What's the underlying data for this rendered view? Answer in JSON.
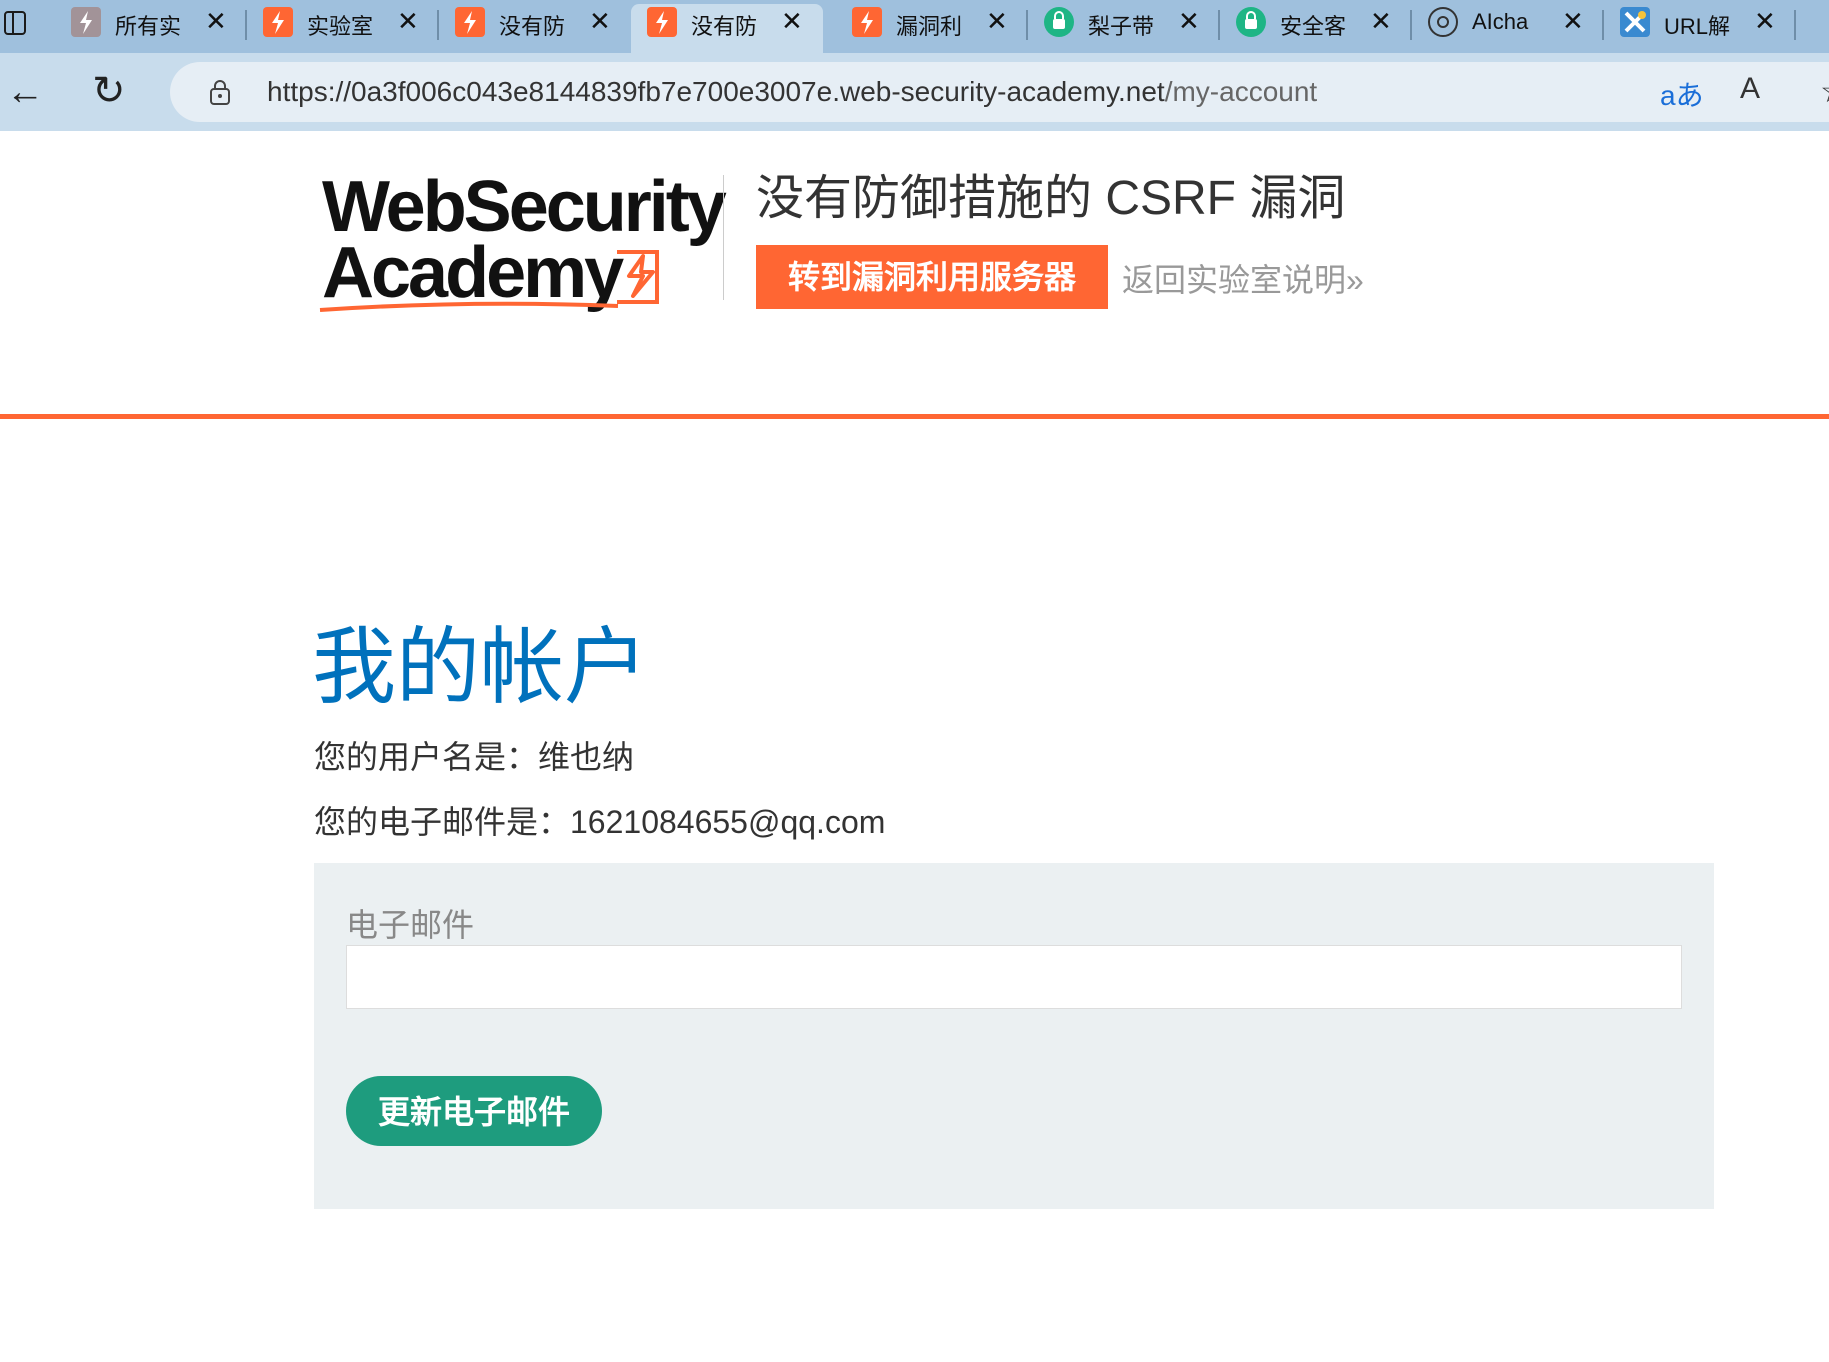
{
  "browser": {
    "tabs": [
      {
        "title": "所有实",
        "favicon": "grey-bolt-icon"
      },
      {
        "title": "实验室",
        "favicon": "bolt-icon"
      },
      {
        "title": "没有防",
        "favicon": "bolt-icon"
      },
      {
        "title": "没有防",
        "favicon": "bolt-icon",
        "active": true
      },
      {
        "title": "漏洞利",
        "favicon": "bolt-icon"
      },
      {
        "title": "梨子带",
        "favicon": "news-icon"
      },
      {
        "title": "安全客",
        "favicon": "news-icon"
      },
      {
        "title": "AIcha",
        "favicon": "openai-icon"
      },
      {
        "title": "URL解",
        "favicon": "tool-icon"
      }
    ],
    "url_host": "https://0a3f006c043e8144839fb7e700e3007e.web-security-academy.net",
    "url_path": "/my-account",
    "translate_label": "aあ",
    "readaloud_label": "A",
    "close_glyph": "✕"
  },
  "header": {
    "logo_line1": "WebSecurity",
    "logo_line2": "Academy",
    "lab_title": "没有防御措施的 CSRF 漏洞",
    "exploit_button": "转到漏洞利用服务器",
    "back_link": "返回实验室说明»"
  },
  "account": {
    "heading": "我的帐户",
    "username_line": "您的用户名是：维也纳",
    "email_line": "您的电子邮件是：1621084655@qq.com",
    "email_label": "电子邮件",
    "email_value": "",
    "update_button": "更新电子邮件"
  },
  "colors": {
    "accent": "#ff6633",
    "heading_blue": "#0071bc",
    "button_green": "#1e9c7e",
    "form_bg": "#ebf0f2"
  }
}
